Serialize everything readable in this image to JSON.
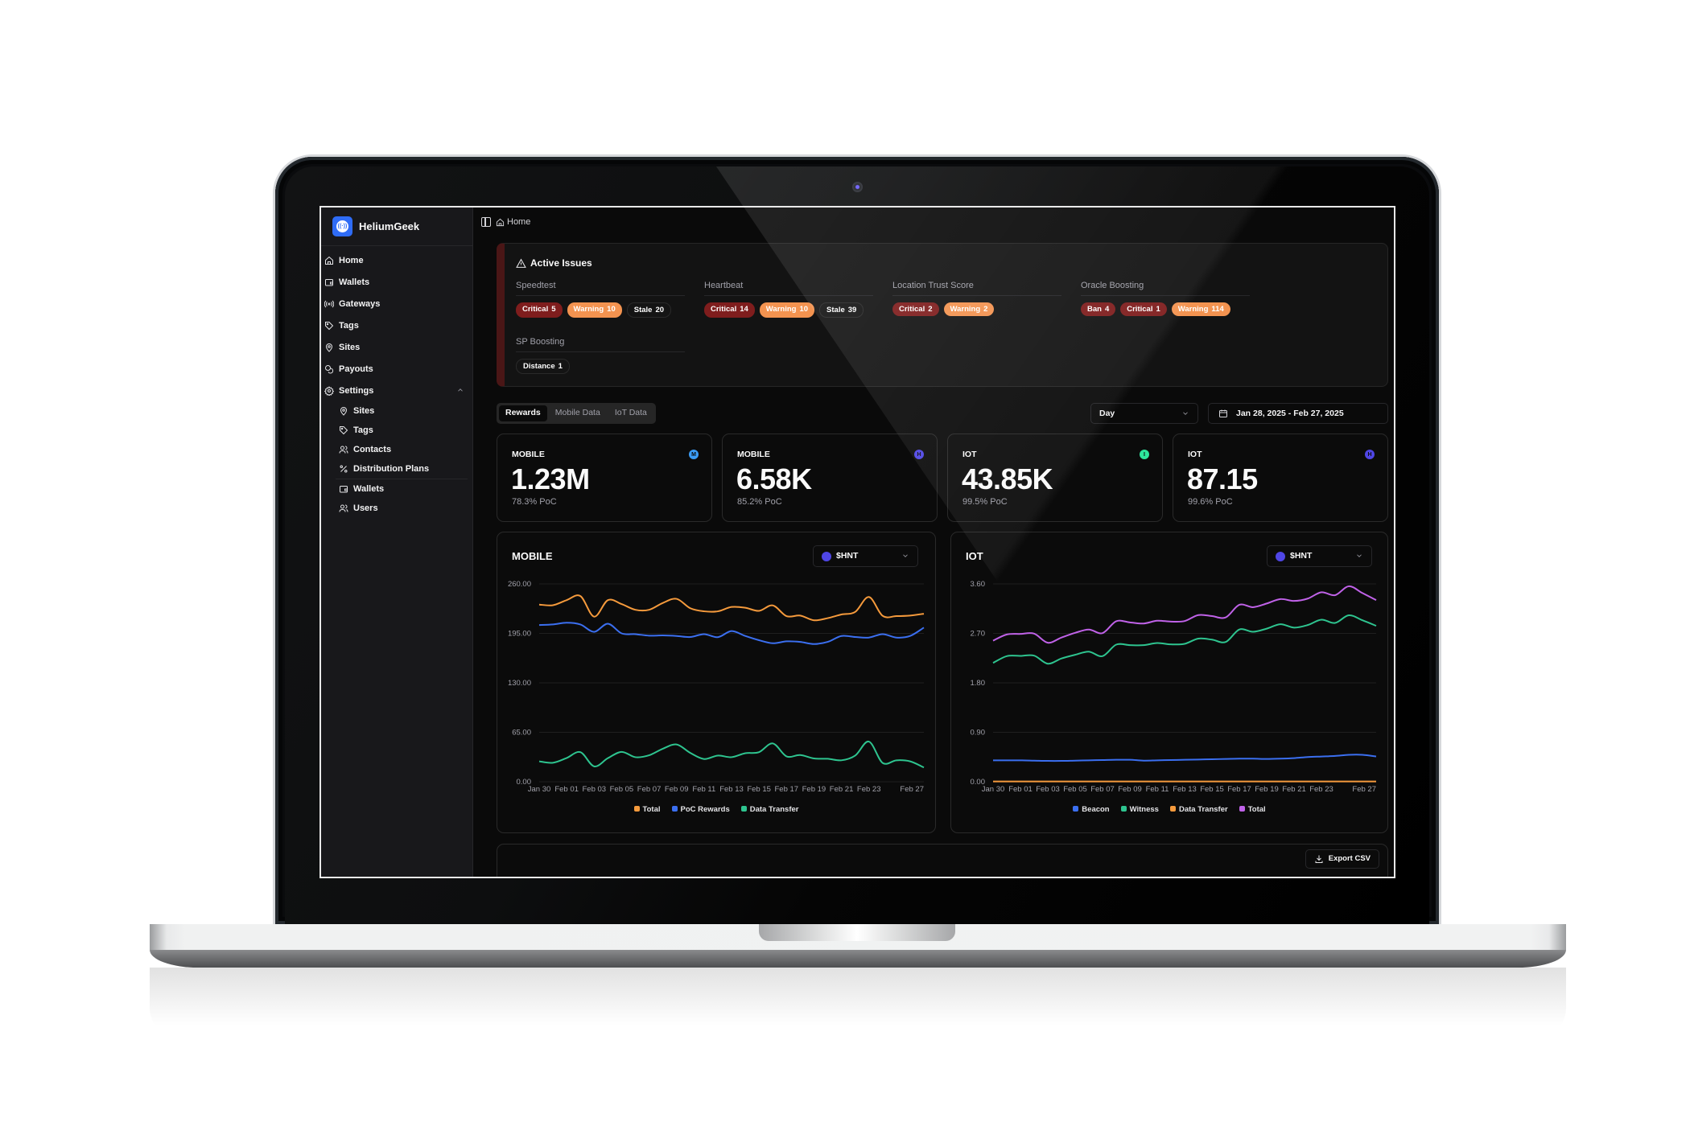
{
  "app": {
    "name": "HeliumGeek"
  },
  "sidebar": {
    "items": [
      {
        "label": "Home",
        "icon": "home-icon"
      },
      {
        "label": "Wallets",
        "icon": "wallet-icon"
      },
      {
        "label": "Gateways",
        "icon": "radio-icon"
      },
      {
        "label": "Tags",
        "icon": "tag-icon"
      },
      {
        "label": "Sites",
        "icon": "map-pin-icon"
      },
      {
        "label": "Payouts",
        "icon": "coins-icon"
      },
      {
        "label": "Settings",
        "icon": "gear-icon",
        "expanded": true
      }
    ],
    "settings_items": [
      {
        "label": "Sites",
        "icon": "map-pin-icon"
      },
      {
        "label": "Tags",
        "icon": "tag-icon"
      },
      {
        "label": "Contacts",
        "icon": "users-icon"
      },
      {
        "label": "Distribution Plans",
        "icon": "percent-icon"
      },
      {
        "label": "Wallets",
        "icon": "wallet-icon"
      },
      {
        "label": "Users",
        "icon": "users-icon"
      }
    ]
  },
  "breadcrumb": {
    "label": "Home"
  },
  "issues": {
    "title": "Active Issues",
    "groups": [
      {
        "label": "Speedtest",
        "pills": [
          {
            "kind": "critical",
            "label": "Critical",
            "count": "5"
          },
          {
            "kind": "warning",
            "label": "Warning",
            "count": "10"
          },
          {
            "kind": "stale",
            "label": "Stale",
            "count": "20"
          }
        ]
      },
      {
        "label": "Heartbeat",
        "pills": [
          {
            "kind": "critical",
            "label": "Critical",
            "count": "14"
          },
          {
            "kind": "warning",
            "label": "Warning",
            "count": "10"
          },
          {
            "kind": "stale",
            "label": "Stale",
            "count": "39"
          }
        ]
      },
      {
        "label": "Location Trust Score",
        "pills": [
          {
            "kind": "critical",
            "label": "Critical",
            "count": "2"
          },
          {
            "kind": "warning",
            "label": "Warning",
            "count": "2"
          }
        ]
      },
      {
        "label": "Oracle Boosting",
        "pills": [
          {
            "kind": "ban",
            "label": "Ban",
            "count": "4"
          },
          {
            "kind": "critical",
            "label": "Critical",
            "count": "1"
          },
          {
            "kind": "warning",
            "label": "Warning",
            "count": "114"
          }
        ]
      },
      {
        "label": "SP Boosting",
        "pills": [
          {
            "kind": "distance",
            "label": "Distance",
            "count": "1"
          }
        ]
      }
    ]
  },
  "tabs": [
    {
      "label": "Rewards",
      "active": true
    },
    {
      "label": "Mobile Data",
      "active": false
    },
    {
      "label": "IoT Data",
      "active": false
    }
  ],
  "filters": {
    "interval": "Day",
    "date_range": "Jan 28, 2025 - Feb 27, 2025"
  },
  "stats": [
    {
      "label": "MOBILE",
      "value": "1.23M",
      "sub": "78.3% PoC",
      "token_color": "#3b9cf5",
      "token_glyph": "M"
    },
    {
      "label": "MOBILE",
      "value": "6.58K",
      "sub": "85.2% PoC",
      "token_color": "#4f46e5",
      "token_glyph": "H"
    },
    {
      "label": "IOT",
      "value": "43.85K",
      "sub": "99.5% PoC",
      "token_color": "#2ee59d",
      "token_glyph": "I"
    },
    {
      "label": "IOT",
      "value": "87.15",
      "sub": "99.6% PoC",
      "token_color": "#4f46e5",
      "token_glyph": "H"
    }
  ],
  "export": {
    "label": "Export CSV"
  },
  "chart_data": [
    {
      "type": "line",
      "title": "MOBILE",
      "token_select": "$HNT",
      "xlabel": "",
      "ylabel": "",
      "ylim": [
        0,
        260
      ],
      "yticks": [
        "0.00",
        "65.00",
        "130.00",
        "195.00",
        "260.00"
      ],
      "grid": true,
      "legend": "bottom",
      "x": [
        "Jan 30",
        "Jan 31",
        "Feb 01",
        "Feb 02",
        "Feb 03",
        "Feb 04",
        "Feb 05",
        "Feb 06",
        "Feb 07",
        "Feb 08",
        "Feb 09",
        "Feb 10",
        "Feb 11",
        "Feb 12",
        "Feb 13",
        "Feb 14",
        "Feb 15",
        "Feb 16",
        "Feb 17",
        "Feb 18",
        "Feb 19",
        "Feb 20",
        "Feb 21",
        "Feb 22",
        "Feb 23",
        "Feb 24",
        "Feb 25",
        "Feb 26",
        "Feb 27"
      ],
      "xtick_labels": [
        "Jan 30",
        "Feb 01",
        "Feb 03",
        "Feb 05",
        "Feb 07",
        "Feb 09",
        "Feb 11",
        "Feb 13",
        "Feb 15",
        "Feb 17",
        "Feb 19",
        "Feb 21",
        "Feb 23",
        "Feb 27"
      ],
      "series": [
        {
          "name": "Total",
          "color": "#f59a3c",
          "values": [
            232.8,
            232,
            238.7,
            244,
            217,
            238.7,
            233.5,
            226,
            226,
            235,
            240.4,
            228,
            224,
            224,
            229.7,
            228.7,
            224.6,
            231.8,
            217.7,
            218.4,
            212.2,
            215,
            219.8,
            223.2,
            242.8,
            218,
            217.7,
            218.4,
            220.8
          ]
        },
        {
          "name": "PoC Rewards",
          "color": "#3b6ff0",
          "values": [
            206,
            206.7,
            209,
            206.7,
            197,
            207.7,
            195,
            194,
            192,
            192.3,
            191.6,
            190.2,
            194,
            190,
            198,
            191.6,
            186,
            182,
            184.5,
            183.8,
            181,
            183.8,
            191.6,
            190.2,
            189.5,
            194,
            189.5,
            191.6,
            202.6
          ]
        },
        {
          "name": "Data Transfer",
          "color": "#2ec48f",
          "values": [
            26.8,
            25,
            31.3,
            38.9,
            20.2,
            31,
            39.3,
            32.3,
            34.8,
            43.4,
            49,
            37.9,
            29.9,
            34.4,
            32.3,
            37.5,
            38.9,
            50.4,
            33.4,
            35.1,
            30.6,
            30.2,
            28.2,
            34.4,
            52.8,
            24.7,
            28.2,
            26.8,
            18.8
          ]
        }
      ]
    },
    {
      "type": "line",
      "title": "IOT",
      "token_select": "$HNT",
      "xlabel": "",
      "ylabel": "",
      "ylim": [
        0,
        3.6
      ],
      "yticks": [
        "0.00",
        "0.90",
        "1.80",
        "2.70",
        "3.60"
      ],
      "grid": true,
      "legend": "bottom",
      "x": [
        "Jan 30",
        "Jan 31",
        "Feb 01",
        "Feb 02",
        "Feb 03",
        "Feb 04",
        "Feb 05",
        "Feb 06",
        "Feb 07",
        "Feb 08",
        "Feb 09",
        "Feb 10",
        "Feb 11",
        "Feb 12",
        "Feb 13",
        "Feb 14",
        "Feb 15",
        "Feb 16",
        "Feb 17",
        "Feb 18",
        "Feb 19",
        "Feb 20",
        "Feb 21",
        "Feb 22",
        "Feb 23",
        "Feb 24",
        "Feb 25",
        "Feb 26",
        "Feb 27"
      ],
      "xtick_labels": [
        "Jan 30",
        "Feb 01",
        "Feb 03",
        "Feb 05",
        "Feb 07",
        "Feb 09",
        "Feb 11",
        "Feb 13",
        "Feb 15",
        "Feb 17",
        "Feb 19",
        "Feb 21",
        "Feb 23",
        "Feb 27"
      ],
      "series": [
        {
          "name": "Beacon",
          "color": "#3b6ff0",
          "values": [
            0.39,
            0.39,
            0.39,
            0.385,
            0.38,
            0.38,
            0.385,
            0.39,
            0.395,
            0.4,
            0.4,
            0.385,
            0.39,
            0.395,
            0.4,
            0.405,
            0.41,
            0.415,
            0.42,
            0.42,
            0.415,
            0.42,
            0.43,
            0.45,
            0.46,
            0.47,
            0.49,
            0.49,
            0.46
          ]
        },
        {
          "name": "Witness",
          "color": "#2ec48f",
          "values": [
            2.162,
            2.286,
            2.29,
            2.295,
            2.148,
            2.243,
            2.31,
            2.367,
            2.286,
            2.495,
            2.486,
            2.486,
            2.524,
            2.5,
            2.51,
            2.605,
            2.586,
            2.543,
            2.771,
            2.729,
            2.786,
            2.867,
            2.805,
            2.852,
            2.948,
            2.89,
            3.029,
            2.938,
            2.838
          ]
        },
        {
          "name": "Data Transfer",
          "color": "#f59a3c",
          "values": [
            0.005,
            0.005,
            0.005,
            0.005,
            0.005,
            0.005,
            0.005,
            0.005,
            0.005,
            0.005,
            0.005,
            0.005,
            0.005,
            0.005,
            0.005,
            0.005,
            0.005,
            0.005,
            0.005,
            0.005,
            0.005,
            0.005,
            0.005,
            0.005,
            0.005,
            0.005,
            0.005,
            0.005,
            0.005
          ]
        },
        {
          "name": "Total",
          "color": "#c062e8",
          "values": [
            2.567,
            2.68,
            2.69,
            2.695,
            2.53,
            2.624,
            2.71,
            2.77,
            2.705,
            2.92,
            2.9,
            2.88,
            2.93,
            2.914,
            2.924,
            3.033,
            3.014,
            2.99,
            3.22,
            3.176,
            3.243,
            3.324,
            3.29,
            3.333,
            3.448,
            3.395,
            3.557,
            3.433,
            3.305
          ]
        }
      ]
    }
  ]
}
